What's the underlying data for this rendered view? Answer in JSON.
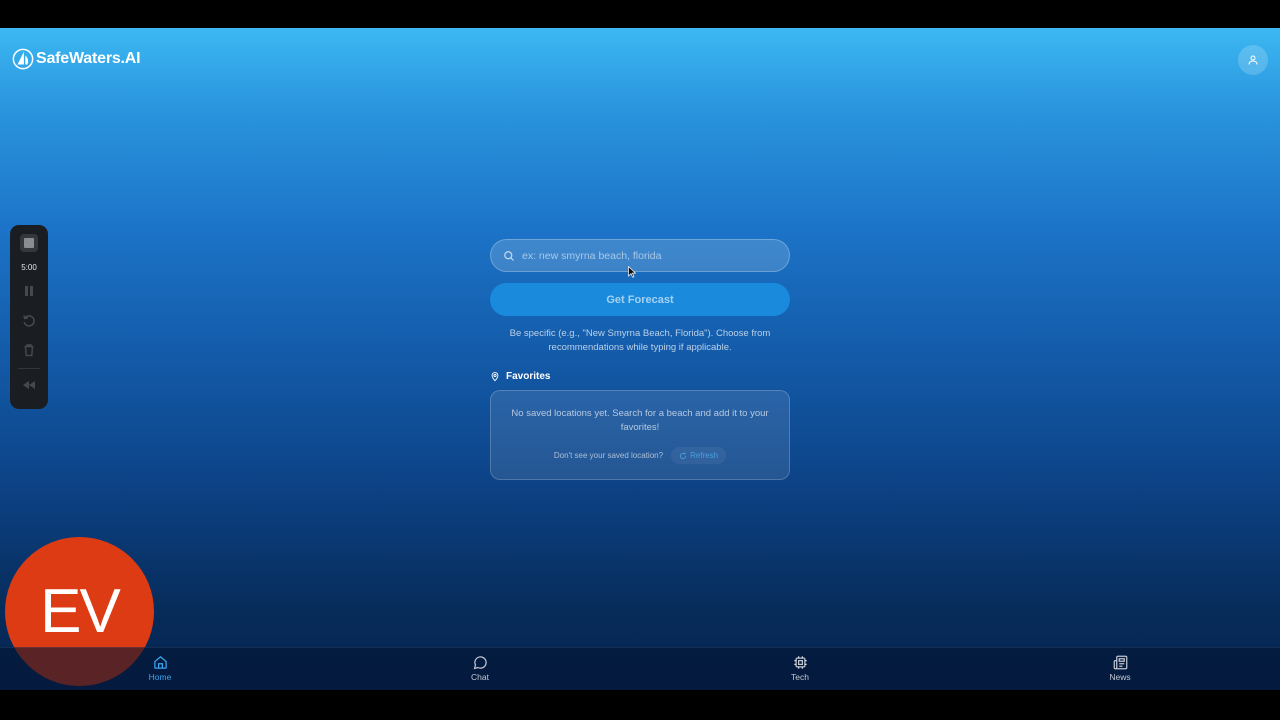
{
  "app": {
    "brand": "SafeWaters.AI"
  },
  "search": {
    "placeholder": "ex: new smyrna beach, florida",
    "value": ""
  },
  "forecast_button": {
    "label": "Get Forecast"
  },
  "hint": {
    "text": "Be specific (e.g., \"New Smyrna Beach, Florida\"). Choose from recommendations while typing if applicable."
  },
  "favorites": {
    "title": "Favorites",
    "empty_text": "No saved locations yet. Search for a beach and add it to your favorites!",
    "missing_prompt": "Don't see your saved location?",
    "refresh_label": "Refresh"
  },
  "recorder": {
    "time": "5:00"
  },
  "overlay": {
    "badge_text": "EV"
  },
  "nav": {
    "items": [
      {
        "label": "Home",
        "icon": "home-icon",
        "active": true
      },
      {
        "label": "Chat",
        "icon": "chat-icon",
        "active": false
      },
      {
        "label": "Tech",
        "icon": "chip-icon",
        "active": false
      },
      {
        "label": "News",
        "icon": "newspaper-icon",
        "active": false
      }
    ]
  },
  "colors": {
    "accent": "#1a8bdc",
    "active_nav": "#3da5ef",
    "badge": "#dd3b13"
  }
}
